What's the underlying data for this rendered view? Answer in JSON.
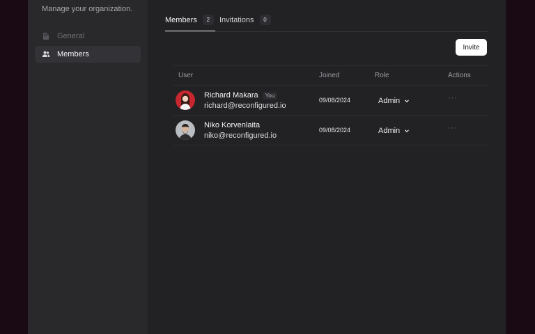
{
  "sidebar": {
    "subtitle": "Manage your organization.",
    "items": [
      {
        "label": "General",
        "icon": "building-icon",
        "active": false
      },
      {
        "label": "Members",
        "icon": "users-icon",
        "active": true
      }
    ]
  },
  "tabs": [
    {
      "label": "Members",
      "count": "2",
      "active": true
    },
    {
      "label": "Invitations",
      "count": "0",
      "active": false
    }
  ],
  "invite_label": "Invite",
  "table": {
    "headers": {
      "user": "User",
      "joined": "Joined",
      "role": "Role",
      "actions": "Actions"
    },
    "rows": [
      {
        "name": "Richard Makara",
        "badge": "You",
        "email": "richard@reconfigured.io",
        "joined": "09/08/2024",
        "role": "Admin",
        "actions": "···",
        "avatar_color": "#c8262e"
      },
      {
        "name": "Niko Korvenlaita",
        "badge": "",
        "email": "niko@reconfigured.io",
        "joined": "09/08/2024",
        "role": "Admin",
        "actions": "···",
        "avatar_color": "#9a9ea3"
      }
    ]
  },
  "colors": {
    "window_bg": "#222225",
    "sidebar_bg": "#29292c",
    "button_bg": "#ffffff"
  }
}
